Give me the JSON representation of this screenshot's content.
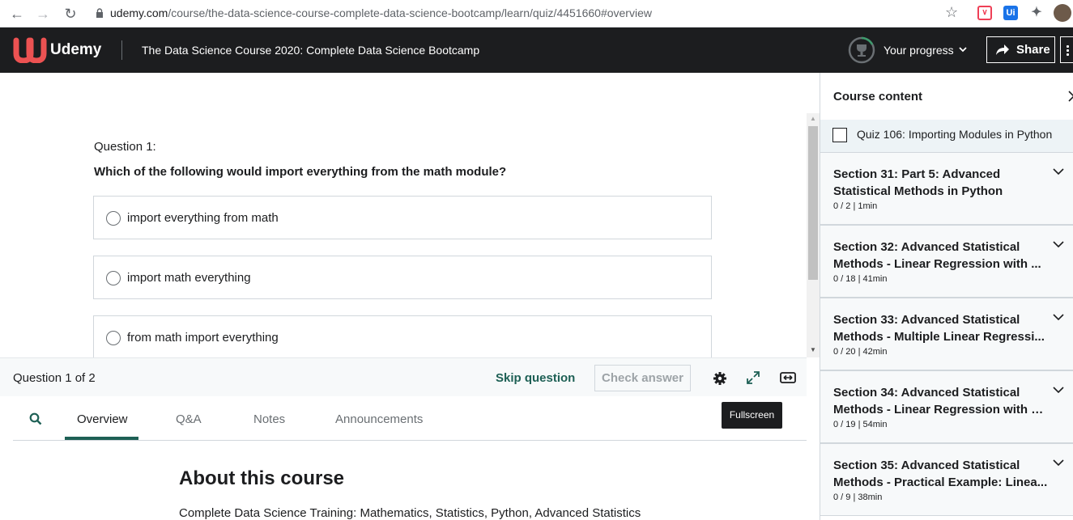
{
  "browser": {
    "url_host": "udemy.com",
    "url_path": "/course/the-data-science-course-complete-data-science-bootcamp/learn/quiz/4451660#overview"
  },
  "header": {
    "logo_text": "Udemy",
    "course_title": "The Data Science Course 2020: Complete Data Science Bootcamp",
    "progress_label": "Your progress",
    "share_label": "Share"
  },
  "quiz": {
    "question_number": "Question 1:",
    "question_text": "Which of the following would import everything from the math module?",
    "options": [
      {
        "label": "import everything from math",
        "selected": false
      },
      {
        "label": "import math everything",
        "selected": false
      },
      {
        "label": "from math import everything",
        "selected": false
      }
    ]
  },
  "footer": {
    "counter": "Question 1 of 2",
    "skip_label": "Skip question",
    "check_label": "Check answer",
    "tooltip": "Fullscreen"
  },
  "tabs": {
    "items": [
      {
        "label": "Overview",
        "active": true
      },
      {
        "label": "Q&A",
        "active": false
      },
      {
        "label": "Notes",
        "active": false
      },
      {
        "label": "Announcements",
        "active": false
      }
    ]
  },
  "overview": {
    "title": "About this course",
    "subtitle": "Complete Data Science Training: Mathematics, Statistics, Python, Advanced Statistics"
  },
  "sidebar": {
    "title": "Course content",
    "current_item": "Quiz 106: Importing Modules in Python",
    "sections": [
      {
        "line1": "Section 31: Part 5: Advanced",
        "line2": "Statistical Methods in Python",
        "meta": "0 / 2 | 1min"
      },
      {
        "line1": "Section 32: Advanced Statistical",
        "line2": "Methods - Linear Regression with ...",
        "meta": "0 / 18 | 41min"
      },
      {
        "line1": "Section 33: Advanced Statistical",
        "line2": "Methods - Multiple Linear Regressi...",
        "meta": "0 / 20 | 42min"
      },
      {
        "line1": "Section 34: Advanced Statistical",
        "line2": "Methods - Linear Regression with s...",
        "meta": "0 / 19 | 54min"
      },
      {
        "line1": "Section 35: Advanced Statistical",
        "line2": "Methods - Practical Example: Linea...",
        "meta": "0 / 9 | 38min"
      }
    ]
  },
  "colors": {
    "header_bg": "#1c1d1f",
    "accent_teal": "#1e6055",
    "logo_red": "#ec5252",
    "progress_ring": "#3d9b6c"
  }
}
